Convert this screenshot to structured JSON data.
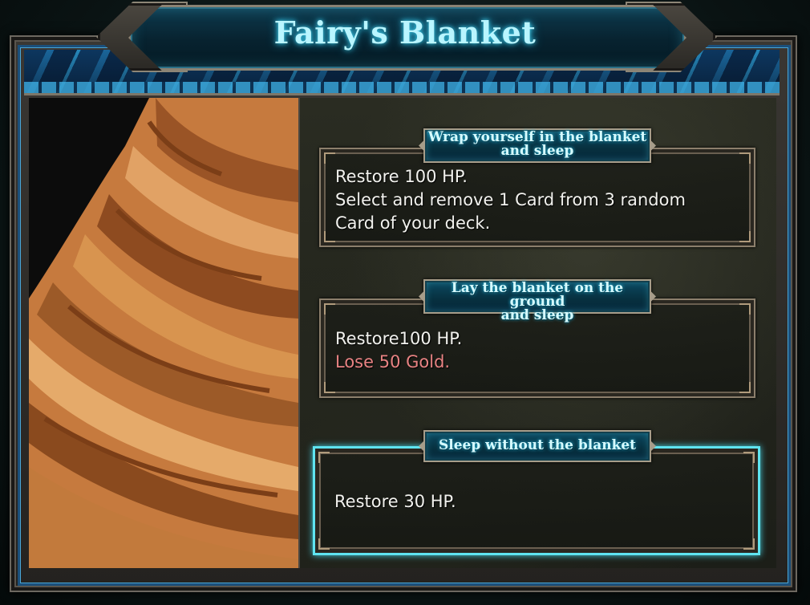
{
  "event": {
    "title": "Fairy's Blanket",
    "image_icon": "blanket-illustration"
  },
  "options": [
    {
      "label_line1": "Wrap yourself in the blanket",
      "label_line2": "and sleep",
      "line1": "Restore 100 HP.",
      "line2": "Select and remove 1 Card from 3 random",
      "line3": "Card of your deck."
    },
    {
      "label_line1": "Lay the blanket on the ground",
      "label_line2": "and sleep",
      "line1": "Restore100 HP.",
      "line2": "Lose 50 Gold."
    },
    {
      "label_line1": "Sleep without the blanket",
      "line1": "Restore 30 HP."
    }
  ],
  "colors": {
    "title_glow": "#43d7f5",
    "selected_border": "#5fe4f0",
    "negative_text": "#e88383",
    "blanket": "#c67a3e"
  }
}
